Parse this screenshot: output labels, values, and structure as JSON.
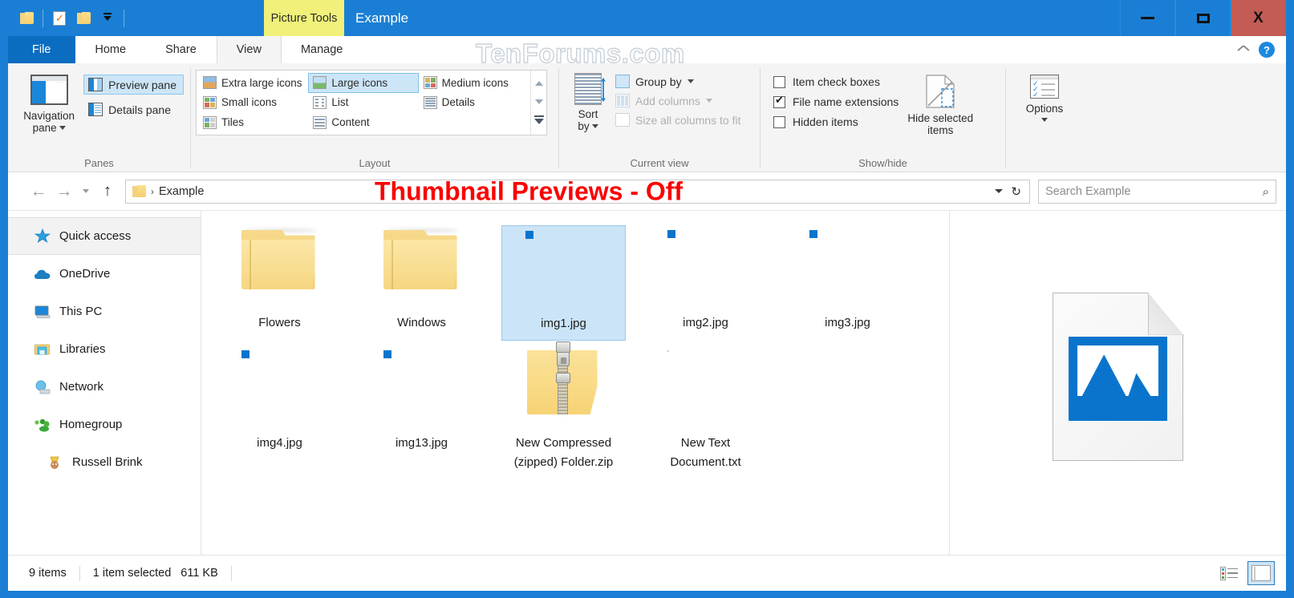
{
  "window": {
    "title": "Example",
    "contextual_tab": "Picture Tools",
    "watermark": "TenForums.com",
    "controls": {
      "minimize": "–",
      "maximize": "❑",
      "close": "X"
    }
  },
  "quick_access_toolbar": {
    "items": [
      {
        "name": "folder-icon",
        "label": ""
      },
      {
        "name": "properties-icon",
        "label": ""
      },
      {
        "name": "new-folder-icon",
        "label": ""
      },
      {
        "name": "customize-dropdown",
        "label": ""
      }
    ]
  },
  "ribbon": {
    "tabs": [
      {
        "label": "File",
        "state": "file"
      },
      {
        "label": "Home",
        "state": "normal"
      },
      {
        "label": "Share",
        "state": "normal"
      },
      {
        "label": "View",
        "state": "active"
      },
      {
        "label": "Manage",
        "state": "contextual"
      }
    ],
    "collapse_icon": "chevron-up-icon",
    "help_icon": "?",
    "groups": {
      "panes": {
        "label": "Panes",
        "navigation_pane": "Navigation\npane",
        "navigation_pane_line1": "Navigation",
        "navigation_pane_line2": "pane",
        "preview_pane": "Preview pane",
        "details_pane": "Details pane",
        "preview_pane_selected": true,
        "details_pane_selected": false
      },
      "layout": {
        "label": "Layout",
        "items": [
          {
            "label": "Extra large icons",
            "selected": false
          },
          {
            "label": "Large icons",
            "selected": true
          },
          {
            "label": "Medium icons",
            "selected": false
          },
          {
            "label": "Small icons",
            "selected": false
          },
          {
            "label": "List",
            "selected": false
          },
          {
            "label": "Details",
            "selected": false
          },
          {
            "label": "Tiles",
            "selected": false
          },
          {
            "label": "Content",
            "selected": false
          }
        ]
      },
      "current_view": {
        "label": "Current view",
        "sort_by_line1": "Sort",
        "sort_by_line2": "by",
        "group_by": "Group by",
        "add_columns": "Add columns",
        "size_all_columns": "Size all columns to fit",
        "add_columns_disabled": true,
        "size_all_columns_disabled": true
      },
      "show_hide": {
        "label": "Show/hide",
        "item_check_boxes": "Item check boxes",
        "item_check_boxes_checked": false,
        "file_name_extensions": "File name extensions",
        "file_name_extensions_checked": true,
        "hidden_items": "Hidden items",
        "hidden_items_checked": false,
        "hide_selected_line1": "Hide selected",
        "hide_selected_line2": "items"
      },
      "options": {
        "label": "Options"
      }
    }
  },
  "address_bar": {
    "back_icon": "←",
    "forward_icon": "→",
    "recent_icon": "⌄",
    "up_icon": "↑",
    "folder_icon": "folder-icon",
    "separator": "›",
    "path": "Example",
    "refresh_icon": "↻",
    "search_placeholder": "Search Example",
    "search_icon": "⌕",
    "overlay_annotation": "Thumbnail Previews - Off",
    "overlay_color": "#fb0000"
  },
  "sidebar": {
    "items": [
      {
        "label": "Quick access",
        "icon": "star-pin-icon",
        "selected": true,
        "child": false
      },
      {
        "label": "OneDrive",
        "icon": "cloud-icon",
        "selected": false,
        "child": false
      },
      {
        "label": "This PC",
        "icon": "monitor-icon",
        "selected": false,
        "child": false
      },
      {
        "label": "Libraries",
        "icon": "libraries-icon",
        "selected": false,
        "child": false
      },
      {
        "label": "Network",
        "icon": "network-icon",
        "selected": false,
        "child": false
      },
      {
        "label": "Homegroup",
        "icon": "homegroup-icon",
        "selected": false,
        "child": false
      },
      {
        "label": "Russell Brink",
        "icon": "user-icon",
        "selected": false,
        "child": true
      }
    ]
  },
  "files": [
    {
      "name": "Flowers",
      "type": "folder",
      "selected": false
    },
    {
      "name": "Windows",
      "type": "folder",
      "selected": false
    },
    {
      "name": "img1.jpg",
      "type": "image",
      "selected": true
    },
    {
      "name": "img2.jpg",
      "type": "image",
      "selected": false
    },
    {
      "name": "img3.jpg",
      "type": "image",
      "selected": false
    },
    {
      "name": "img4.jpg",
      "type": "image",
      "selected": false
    },
    {
      "name": "img13.jpg",
      "type": "image",
      "selected": false
    },
    {
      "name": "New Compressed (zipped) Folder.zip",
      "type": "zip",
      "selected": false
    },
    {
      "name": "New Text Document.txt",
      "type": "text",
      "selected": false
    }
  ],
  "preview_pane": {
    "icon": "generic-jpg-icon"
  },
  "status_bar": {
    "item_count": "9 items",
    "selection": "1 item selected",
    "size": "611 KB",
    "view_details_icon": "details-view-icon",
    "view_large_icons_icon": "large-icons-view-icon",
    "large_icons_selected": true
  }
}
